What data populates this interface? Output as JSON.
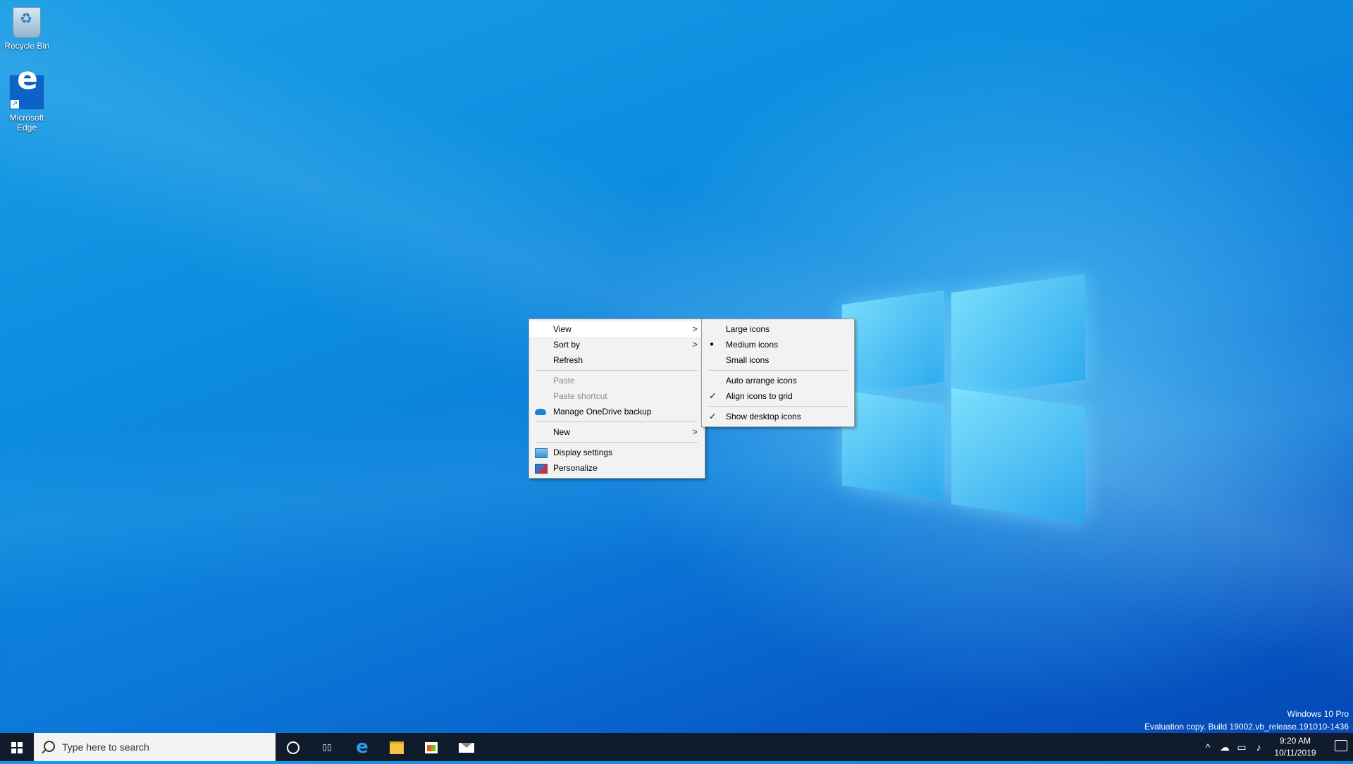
{
  "desktop": {
    "icons": [
      {
        "label": "Recycle Bin",
        "icon": "recycle-bin-icon"
      },
      {
        "label": "Microsoft Edge",
        "icon": "edge-icon"
      }
    ]
  },
  "context_menu": {
    "items": [
      {
        "label": "View",
        "has_submenu": true,
        "highlighted": true
      },
      {
        "label": "Sort by",
        "has_submenu": true
      },
      {
        "label": "Refresh"
      },
      {
        "separator": true
      },
      {
        "label": "Paste",
        "disabled": true
      },
      {
        "label": "Paste shortcut",
        "disabled": true
      },
      {
        "label": "Manage OneDrive backup",
        "icon": "onedrive-icon"
      },
      {
        "separator": true
      },
      {
        "label": "New",
        "has_submenu": true
      },
      {
        "separator": true
      },
      {
        "label": "Display settings",
        "icon": "display-icon"
      },
      {
        "label": "Personalize",
        "icon": "personalize-icon"
      }
    ]
  },
  "view_submenu": {
    "items": [
      {
        "label": "Large icons",
        "mark": ""
      },
      {
        "label": "Medium icons",
        "mark": "●"
      },
      {
        "label": "Small icons",
        "mark": ""
      },
      {
        "separator": true
      },
      {
        "label": "Auto arrange icons",
        "mark": ""
      },
      {
        "label": "Align icons to grid",
        "mark": "✓"
      },
      {
        "separator": true
      },
      {
        "label": "Show desktop icons",
        "mark": "✓"
      }
    ]
  },
  "watermark": {
    "line1": "Windows 10 Pro",
    "line2": "Evaluation copy. Build 19002.vb_release.191010-1436"
  },
  "taskbar": {
    "search_placeholder": "Type here to search",
    "time": "9:20 AM",
    "date": "10/11/2019",
    "pinned": [
      "cortana-icon",
      "task-view-icon",
      "edge-icon",
      "file-explorer-icon",
      "store-icon",
      "mail-icon"
    ]
  },
  "colors": {
    "taskbar": "#101c2c",
    "menu_bg": "#f2f2f2",
    "accent": "#0b78d8"
  }
}
